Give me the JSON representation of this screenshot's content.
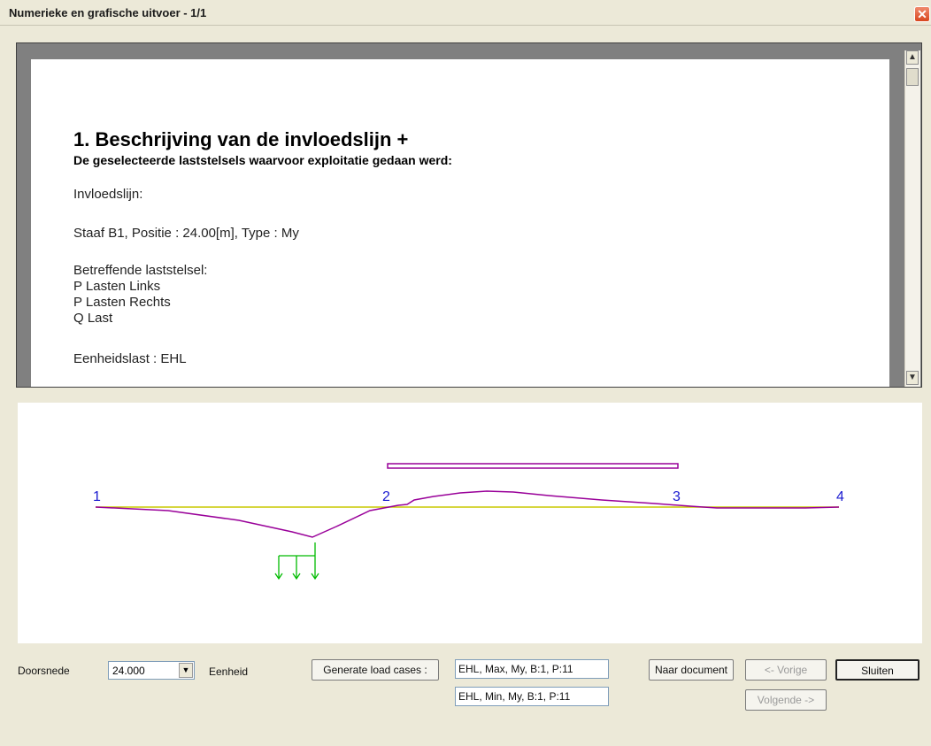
{
  "window": {
    "title": "Numerieke en grafische uitvoer - 1/1",
    "close_glyph": "✕"
  },
  "report": {
    "heading": "1.  Beschrijving  van  de  invloedslijn  +",
    "subheading": "De  geselecteerde laststelsels  waarvoor  exploitatie  gedaan  werd:",
    "line1": "Invloedslijn:",
    "line2": "Staaf  B1,  Positie  :    24.00[m],  Type  :    My",
    "line3": "Betreffende  laststelsel:",
    "line4": "P  Lasten  Links",
    "line5": "P  Lasten  Rechts",
    "line6": "Q  Last",
    "line7": "Eenheidslast  :    EHL"
  },
  "graphic": {
    "nodes": [
      "1",
      "2",
      "3",
      "4"
    ],
    "colors": {
      "node_labels": "#1a1ad0",
      "baseline": "#c8c800",
      "influence_line": "#990099",
      "loads": "#00bb00"
    }
  },
  "controls": {
    "doorsnede_label": "Doorsnede",
    "doorsnede_value": "24.000",
    "eenheid_label": "Eenheid",
    "generate_label": "Generate load cases :",
    "case_max": "EHL, Max, My, B:1, P:11",
    "case_min": "EHL, Min, My, B:1, P:11",
    "naar_document_label": "Naar document",
    "vorige_label": "<- Vorige",
    "volgende_label": "Volgende ->",
    "sluiten_label": "Sluiten"
  }
}
